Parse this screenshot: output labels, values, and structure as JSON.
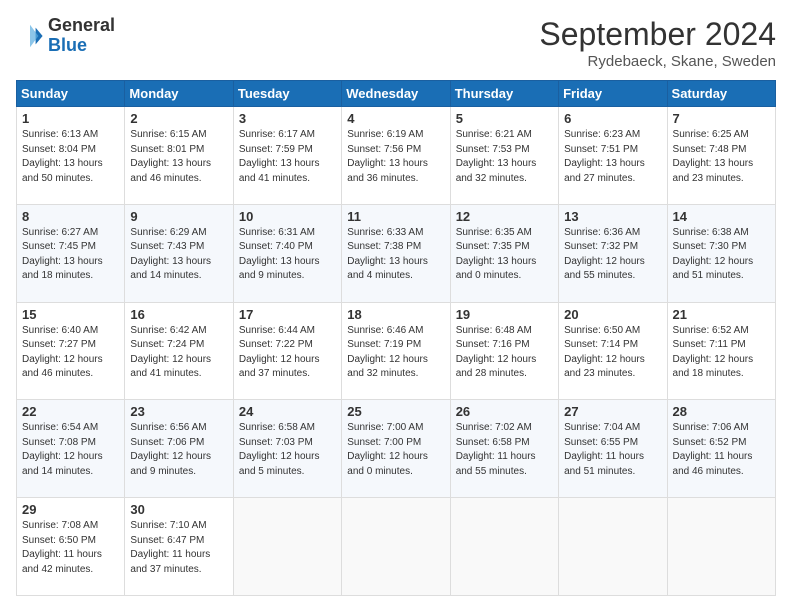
{
  "logo": {
    "general": "General",
    "blue": "Blue"
  },
  "header": {
    "month": "September 2024",
    "location": "Rydebaeck, Skane, Sweden"
  },
  "weekdays": [
    "Sunday",
    "Monday",
    "Tuesday",
    "Wednesday",
    "Thursday",
    "Friday",
    "Saturday"
  ],
  "weeks": [
    [
      {
        "day": "1",
        "text": "Sunrise: 6:13 AM\nSunset: 8:04 PM\nDaylight: 13 hours\nand 50 minutes."
      },
      {
        "day": "2",
        "text": "Sunrise: 6:15 AM\nSunset: 8:01 PM\nDaylight: 13 hours\nand 46 minutes."
      },
      {
        "day": "3",
        "text": "Sunrise: 6:17 AM\nSunset: 7:59 PM\nDaylight: 13 hours\nand 41 minutes."
      },
      {
        "day": "4",
        "text": "Sunrise: 6:19 AM\nSunset: 7:56 PM\nDaylight: 13 hours\nand 36 minutes."
      },
      {
        "day": "5",
        "text": "Sunrise: 6:21 AM\nSunset: 7:53 PM\nDaylight: 13 hours\nand 32 minutes."
      },
      {
        "day": "6",
        "text": "Sunrise: 6:23 AM\nSunset: 7:51 PM\nDaylight: 13 hours\nand 27 minutes."
      },
      {
        "day": "7",
        "text": "Sunrise: 6:25 AM\nSunset: 7:48 PM\nDaylight: 13 hours\nand 23 minutes."
      }
    ],
    [
      {
        "day": "8",
        "text": "Sunrise: 6:27 AM\nSunset: 7:45 PM\nDaylight: 13 hours\nand 18 minutes."
      },
      {
        "day": "9",
        "text": "Sunrise: 6:29 AM\nSunset: 7:43 PM\nDaylight: 13 hours\nand 14 minutes."
      },
      {
        "day": "10",
        "text": "Sunrise: 6:31 AM\nSunset: 7:40 PM\nDaylight: 13 hours\nand 9 minutes."
      },
      {
        "day": "11",
        "text": "Sunrise: 6:33 AM\nSunset: 7:38 PM\nDaylight: 13 hours\nand 4 minutes."
      },
      {
        "day": "12",
        "text": "Sunrise: 6:35 AM\nSunset: 7:35 PM\nDaylight: 13 hours\nand 0 minutes."
      },
      {
        "day": "13",
        "text": "Sunrise: 6:36 AM\nSunset: 7:32 PM\nDaylight: 12 hours\nand 55 minutes."
      },
      {
        "day": "14",
        "text": "Sunrise: 6:38 AM\nSunset: 7:30 PM\nDaylight: 12 hours\nand 51 minutes."
      }
    ],
    [
      {
        "day": "15",
        "text": "Sunrise: 6:40 AM\nSunset: 7:27 PM\nDaylight: 12 hours\nand 46 minutes."
      },
      {
        "day": "16",
        "text": "Sunrise: 6:42 AM\nSunset: 7:24 PM\nDaylight: 12 hours\nand 41 minutes."
      },
      {
        "day": "17",
        "text": "Sunrise: 6:44 AM\nSunset: 7:22 PM\nDaylight: 12 hours\nand 37 minutes."
      },
      {
        "day": "18",
        "text": "Sunrise: 6:46 AM\nSunset: 7:19 PM\nDaylight: 12 hours\nand 32 minutes."
      },
      {
        "day": "19",
        "text": "Sunrise: 6:48 AM\nSunset: 7:16 PM\nDaylight: 12 hours\nand 28 minutes."
      },
      {
        "day": "20",
        "text": "Sunrise: 6:50 AM\nSunset: 7:14 PM\nDaylight: 12 hours\nand 23 minutes."
      },
      {
        "day": "21",
        "text": "Sunrise: 6:52 AM\nSunset: 7:11 PM\nDaylight: 12 hours\nand 18 minutes."
      }
    ],
    [
      {
        "day": "22",
        "text": "Sunrise: 6:54 AM\nSunset: 7:08 PM\nDaylight: 12 hours\nand 14 minutes."
      },
      {
        "day": "23",
        "text": "Sunrise: 6:56 AM\nSunset: 7:06 PM\nDaylight: 12 hours\nand 9 minutes."
      },
      {
        "day": "24",
        "text": "Sunrise: 6:58 AM\nSunset: 7:03 PM\nDaylight: 12 hours\nand 5 minutes."
      },
      {
        "day": "25",
        "text": "Sunrise: 7:00 AM\nSunset: 7:00 PM\nDaylight: 12 hours\nand 0 minutes."
      },
      {
        "day": "26",
        "text": "Sunrise: 7:02 AM\nSunset: 6:58 PM\nDaylight: 11 hours\nand 55 minutes."
      },
      {
        "day": "27",
        "text": "Sunrise: 7:04 AM\nSunset: 6:55 PM\nDaylight: 11 hours\nand 51 minutes."
      },
      {
        "day": "28",
        "text": "Sunrise: 7:06 AM\nSunset: 6:52 PM\nDaylight: 11 hours\nand 46 minutes."
      }
    ],
    [
      {
        "day": "29",
        "text": "Sunrise: 7:08 AM\nSunset: 6:50 PM\nDaylight: 11 hours\nand 42 minutes."
      },
      {
        "day": "30",
        "text": "Sunrise: 7:10 AM\nSunset: 6:47 PM\nDaylight: 11 hours\nand 37 minutes."
      },
      {
        "day": "",
        "text": ""
      },
      {
        "day": "",
        "text": ""
      },
      {
        "day": "",
        "text": ""
      },
      {
        "day": "",
        "text": ""
      },
      {
        "day": "",
        "text": ""
      }
    ]
  ]
}
